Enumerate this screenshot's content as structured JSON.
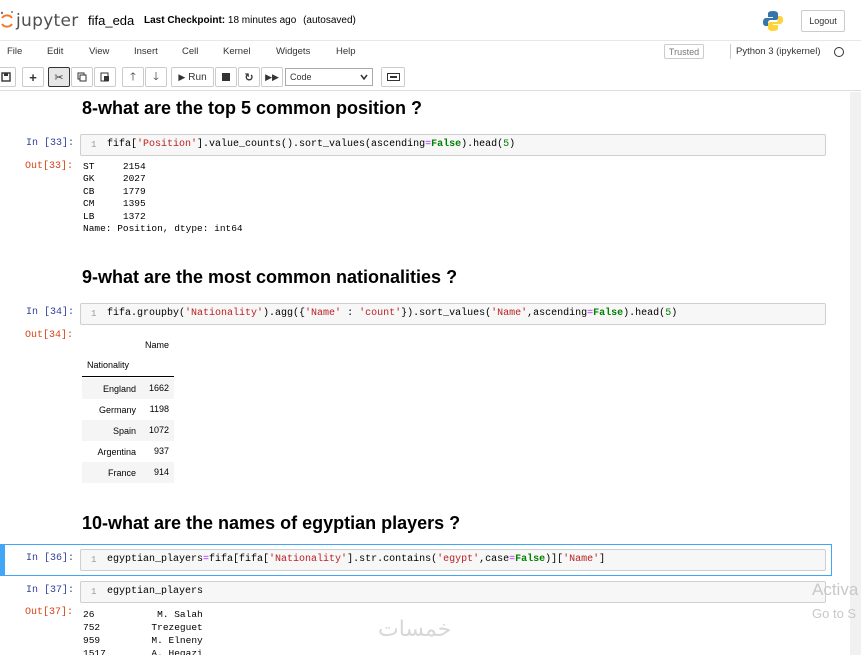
{
  "header": {
    "logo_text": "jupyter",
    "notebook_name": "fifa_eda",
    "checkpoint_label": "Last Checkpoint:",
    "checkpoint_time": "18 minutes ago",
    "autosave_status": "(autosaved)",
    "logout_label": "Logout"
  },
  "menubar": {
    "items": [
      "File",
      "Edit",
      "View",
      "Insert",
      "Cell",
      "Kernel",
      "Widgets",
      "Help"
    ],
    "trusted_label": "Trusted",
    "kernel_name": "Python 3 (ipykernel)"
  },
  "toolbar": {
    "run_label": "Run",
    "cell_type": "Code"
  },
  "cells": {
    "h8": "8-what are the top 5 common position ?",
    "in33_prompt": "In [33]:",
    "out33_prompt": "Out[33]:",
    "out33_text": "ST     2154\nGK     2027\nCB     1779\nCM     1395\nLB     1372\nName: Position, dtype: int64",
    "h9": "9-what are the most common nationalities ?",
    "in34_prompt": "In [34]:",
    "out34_prompt": "Out[34]:",
    "df34": {
      "column": "Name",
      "index_name": "Nationality",
      "rows": [
        {
          "index": "England",
          "value": "1662"
        },
        {
          "index": "Germany",
          "value": "1198"
        },
        {
          "index": "Spain",
          "value": "1072"
        },
        {
          "index": "Argentina",
          "value": "937"
        },
        {
          "index": "France",
          "value": "914"
        }
      ]
    },
    "h10": "10-what are the names of egyptian players ?",
    "in36_prompt": "In [36]:",
    "in37_prompt": "In [37]:",
    "in37_code": "egyptian_players",
    "out37_prompt": "Out[37]:",
    "out37_text": "26           M. Salah\n752         Trezeguet\n959         M. Elneny\n1517        A. Hegazi",
    "line_number": "1"
  },
  "overlay": {
    "watermark": "خمسات",
    "activate_1": "Activa",
    "activate_2": "Go to S"
  }
}
